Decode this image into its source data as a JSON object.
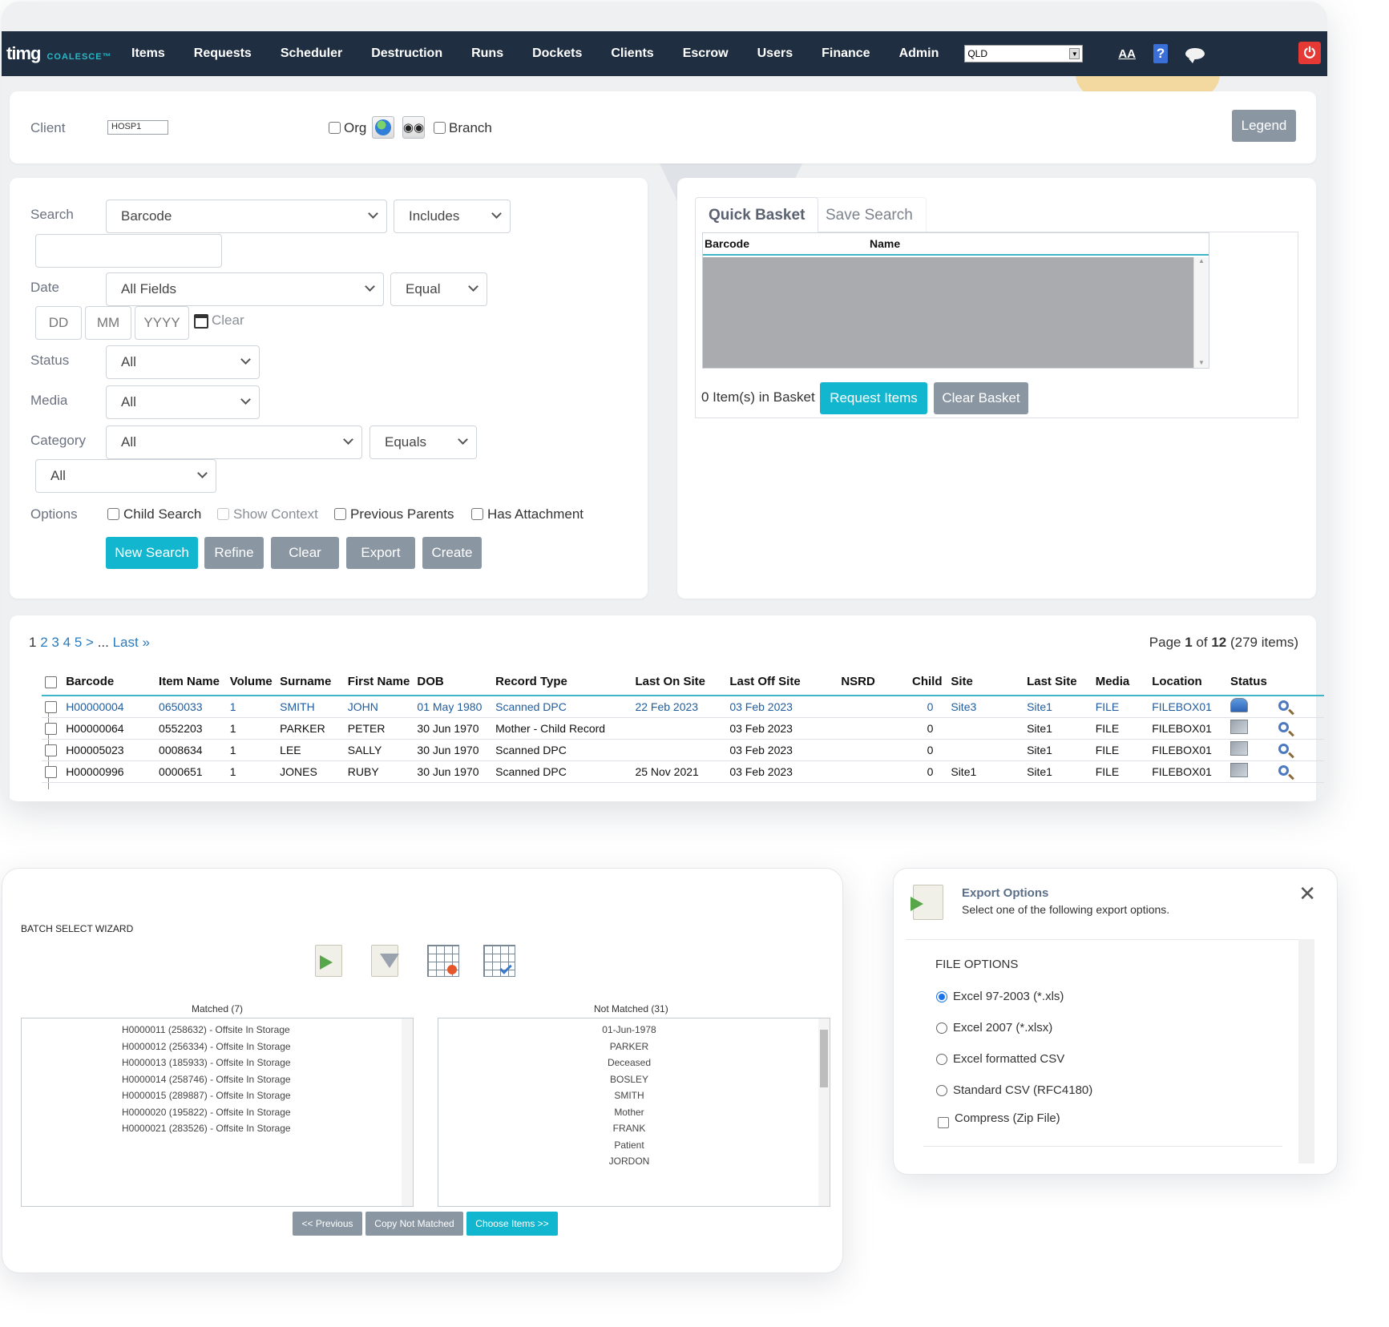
{
  "brand": {
    "logo": "timg",
    "product": "COALESCE™"
  },
  "nav": {
    "items": [
      "Items",
      "Requests",
      "Scheduler",
      "Destruction",
      "Runs",
      "Dockets",
      "Clients",
      "Escrow",
      "Users",
      "Finance",
      "Admin"
    ],
    "region": "QLD",
    "font_label": "AA",
    "help_label": "?"
  },
  "client": {
    "label": "Client",
    "value": "HOSP1",
    "org_label": "Org",
    "branch_label": "Branch",
    "legend_button": "Legend"
  },
  "search": {
    "search_label": "Search",
    "search_field": "Barcode",
    "search_operator": "Includes",
    "date_label": "Date",
    "date_field": "All Fields",
    "date_operator": "Equal",
    "dd": "DD",
    "mm": "MM",
    "yyyy": "YYYY",
    "clear_link": "Clear",
    "status_label": "Status",
    "status_value": "All",
    "media_label": "Media",
    "media_value": "All",
    "category_label": "Category",
    "category_value": "All",
    "category_operator": "Equals",
    "category_sub": "All",
    "options_label": "Options",
    "options": [
      "Child Search",
      "Show Context",
      "Previous Parents",
      "Has Attachment"
    ],
    "buttons": {
      "new_search": "New Search",
      "refine": "Refine",
      "clear": "Clear",
      "export": "Export",
      "create": "Create"
    }
  },
  "basket": {
    "tab_active": "Quick Basket",
    "tab_inactive": "Save Search",
    "col_barcode": "Barcode",
    "col_name": "Name",
    "count_text": "0 Item(s) in Basket",
    "request_button": "Request Items",
    "clear_button": "Clear Basket"
  },
  "results": {
    "pager": {
      "current": "1",
      "pages": [
        "2",
        "3",
        "4",
        "5",
        ">"
      ],
      "ellipsis": "...",
      "last": "Last »"
    },
    "page_info": {
      "prefix": "Page ",
      "page": "1",
      "of": " of ",
      "total_pages": "12",
      "items": " (279 items)"
    },
    "columns": [
      "Barcode",
      "Item Name",
      "Volume",
      "Surname",
      "First Name",
      "DOB",
      "Record Type",
      "Last On Site",
      "Last Off Site",
      "NSRD",
      "Child",
      "Site",
      "Last Site",
      "Media",
      "Location",
      "Status"
    ],
    "rows": [
      [
        "H00000004",
        "0650033",
        "1",
        "SMITH",
        "JOHN",
        "01 May 1980",
        "Scanned DPC",
        "22 Feb 2023",
        "03 Feb 2023",
        "",
        "0",
        "Site3",
        "Site1",
        "FILE",
        "FILEBOX01"
      ],
      [
        "H00000064",
        "0552203",
        "1",
        "PARKER",
        "PETER",
        "30 Jun 1970",
        "Mother - Child Record",
        "",
        "03 Feb 2023",
        "",
        "0",
        "",
        "Site1",
        "FILE",
        "FILEBOX01"
      ],
      [
        "H00005023",
        "0008634",
        "1",
        "LEE",
        "SALLY",
        "30 Jun 1970",
        "Scanned DPC",
        "",
        "03 Feb 2023",
        "",
        "0",
        "",
        "Site1",
        "FILE",
        "FILEBOX01"
      ],
      [
        "H00000996",
        "0000651",
        "1",
        "JONES",
        "RUBY",
        "30 Jun 1970",
        "Scanned DPC",
        "25 Nov 2021",
        "03 Feb 2023",
        "",
        "0",
        "Site1",
        "Site1",
        "FILE",
        "FILEBOX01"
      ]
    ]
  },
  "wizard": {
    "title": "BATCH SELECT WIZARD",
    "matched_caption": "Matched (7)",
    "matched": [
      "H0000011 (258632)  - Offsite In Storage",
      "H0000012 (256334)  - Offsite In Storage",
      "H0000013 (185933)  - Offsite In Storage",
      "H0000014 (258746)  - Offsite In Storage",
      "H0000015 (289887)  - Offsite In Storage",
      "H0000020 (195822)  - Offsite In Storage",
      "H0000021 (283526)  - Offsite In Storage"
    ],
    "not_matched_caption": "Not Matched (31)",
    "not_matched": [
      "01-Jun-1978",
      "PARKER",
      "Deceased",
      "BOSLEY",
      "SMITH",
      "Mother",
      "FRANK",
      "Patient",
      "JORDON"
    ],
    "prev_button": "<< Previous",
    "copy_button": "Copy Not Matched",
    "choose_button": "Choose Items >>"
  },
  "export": {
    "title": "Export Options",
    "subtitle": "Select one of the following export options.",
    "section": "FILE OPTIONS",
    "options": [
      "Excel 97-2003 (*.xls)",
      "Excel 2007 (*.xlsx)",
      "Excel formatted CSV",
      "Standard CSV (RFC4180)"
    ],
    "compress": "Compress (Zip File)"
  },
  "colors": {
    "navbar": "#1f2e40",
    "teal": "#12b6cf",
    "grey_button": "#8a96a2",
    "accent_logo": "#28b8c8"
  }
}
